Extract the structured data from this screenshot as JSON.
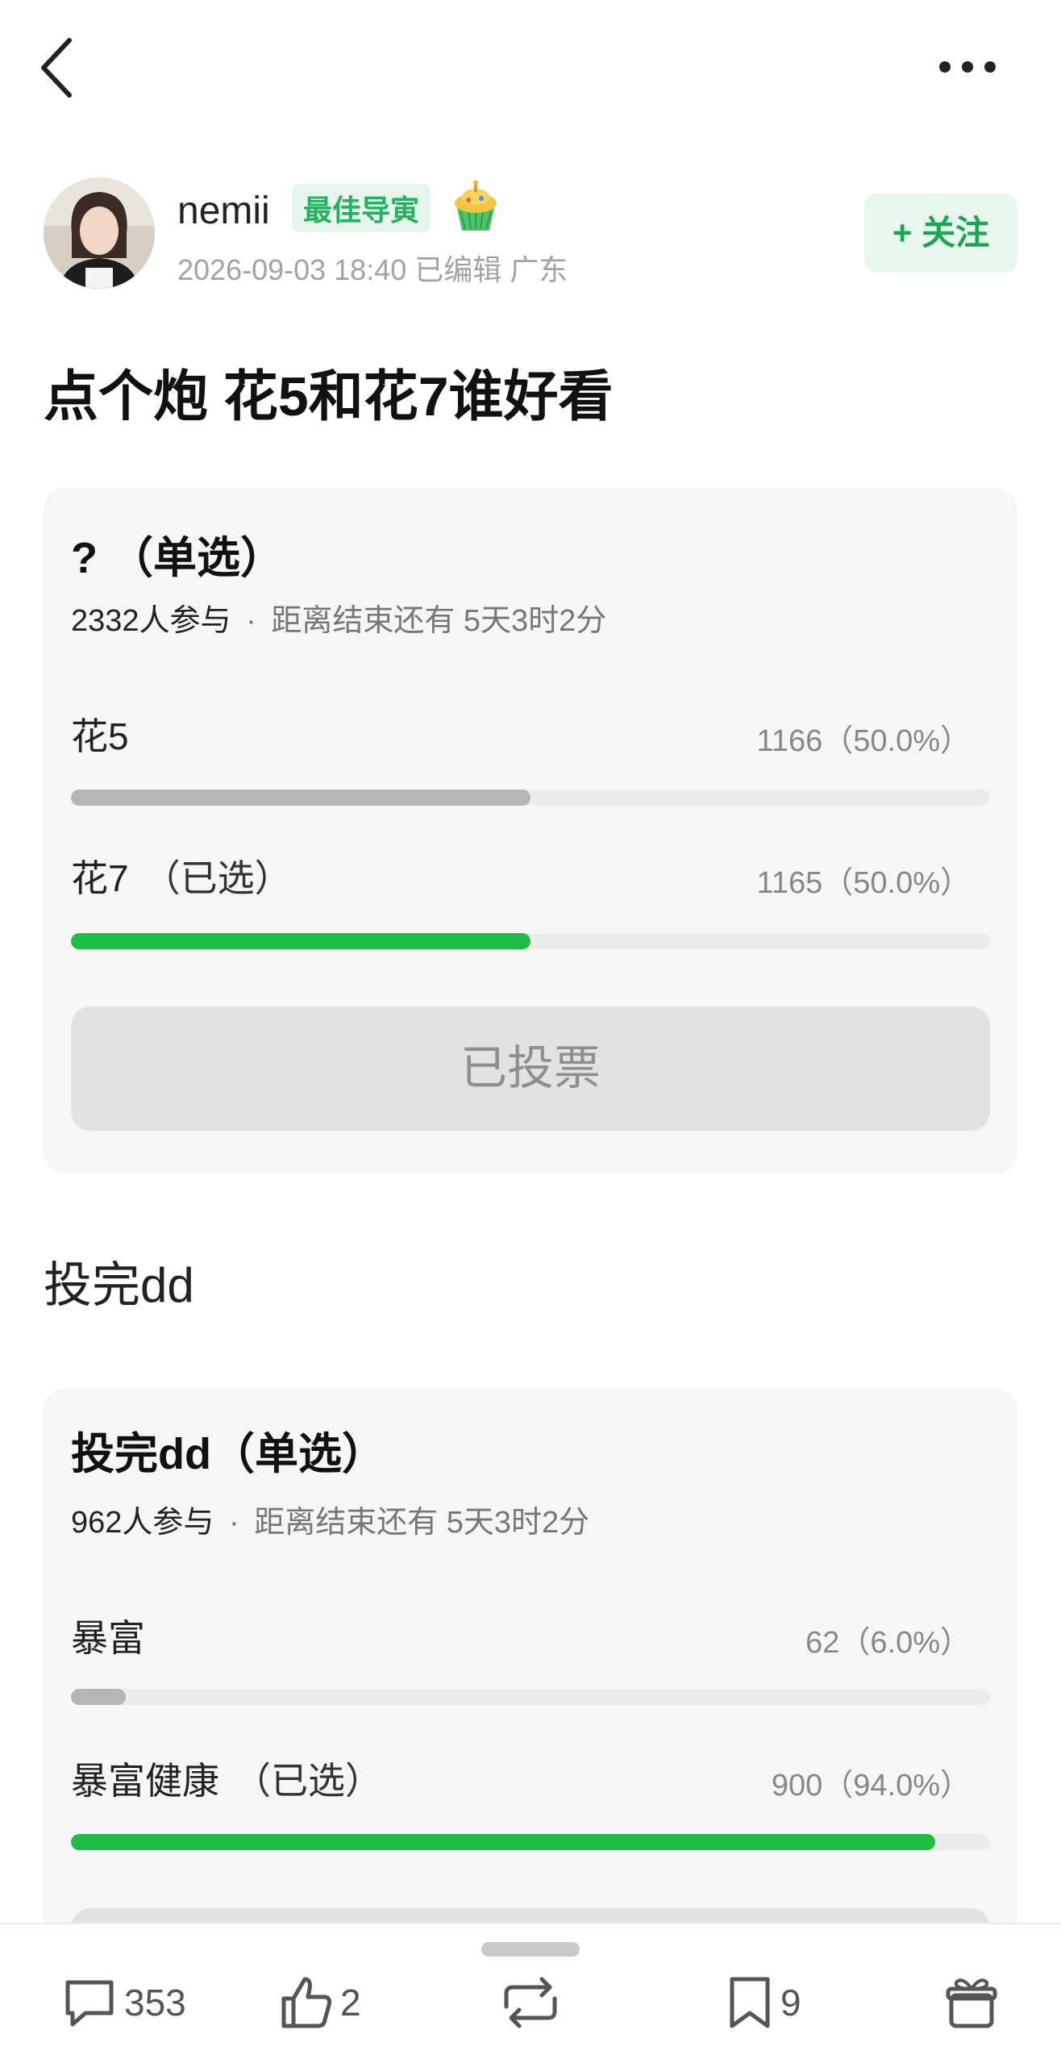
{
  "author": {
    "name": "nemii",
    "badge": "最佳导寅",
    "meta": "2026-09-03 18:40  已编辑  广东",
    "follow_label": "+ 关注"
  },
  "post": {
    "title": "点个炮 花5和花7谁好看",
    "body_text": "投完dd"
  },
  "poll1": {
    "title": "? （单选）",
    "participants": "2332人参与",
    "separator": "·",
    "deadline": "距离结束还有 5天3时2分",
    "options": [
      {
        "label": "花5",
        "selected_tag": "",
        "value": "1166（50.0%）",
        "fraction": 0.5,
        "selected": false
      },
      {
        "label": "花7",
        "selected_tag": "（已选）",
        "value": "1165（50.0%）",
        "fraction": 0.5,
        "selected": true
      }
    ],
    "button_label": "已投票"
  },
  "poll2": {
    "title": "投完dd（单选）",
    "participants": "962人参与",
    "separator": "·",
    "deadline": "距离结束还有 5天3时2分",
    "options": [
      {
        "label": "暴富",
        "selected_tag": "",
        "value": "62（6.0%）",
        "fraction": 0.06,
        "selected": false
      },
      {
        "label": "暴富健康",
        "selected_tag": "（已选）",
        "value": "900（94.0%）",
        "fraction": 0.94,
        "selected": true
      }
    ]
  },
  "bottom_bar": {
    "comments": "353",
    "likes": "2",
    "bookmarks": "9"
  },
  "colors": {
    "accent_green": "#1ebe46",
    "badge_green": "#25b161",
    "card_bg": "#f6f6f6"
  },
  "icons": [
    "back-icon",
    "more-icon",
    "cake-icon",
    "comment-icon",
    "like-icon",
    "repost-icon",
    "bookmark-icon",
    "gift-icon"
  ]
}
